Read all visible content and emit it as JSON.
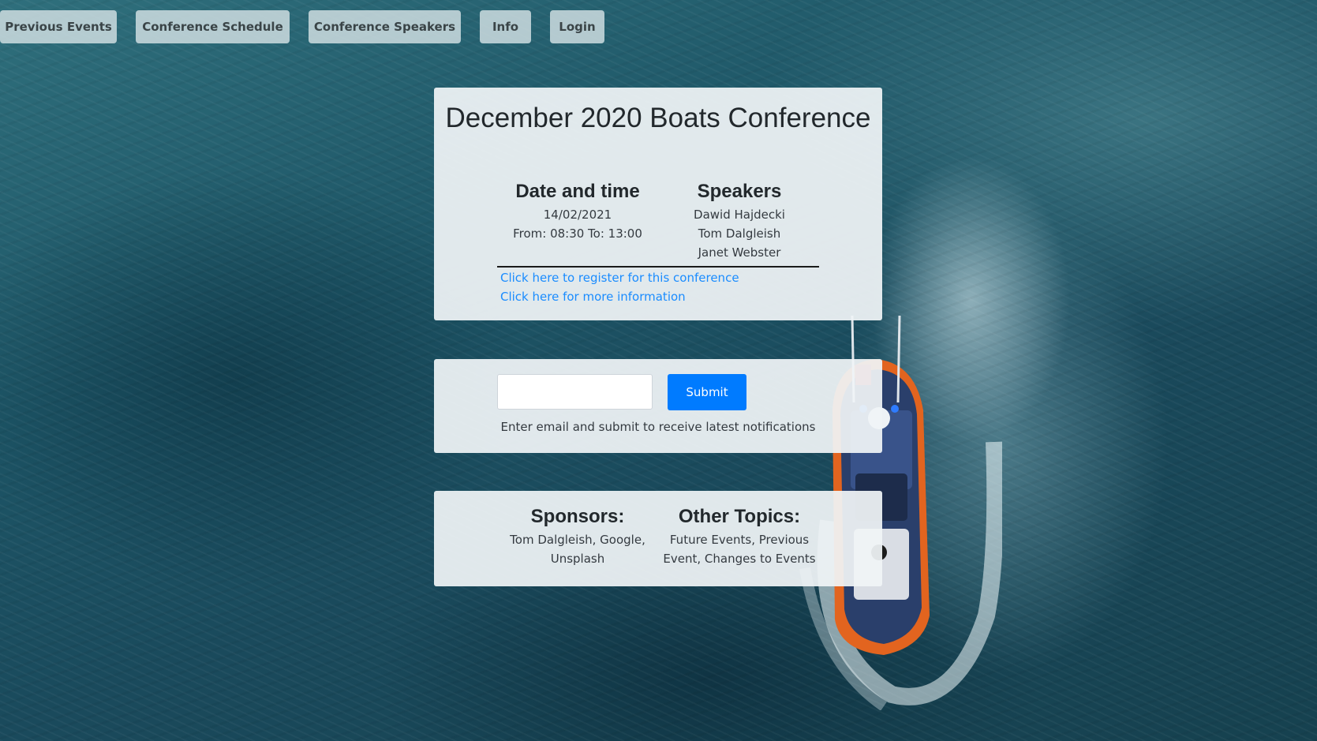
{
  "nav": {
    "items": [
      {
        "label": "Previous Events"
      },
      {
        "label": "Conference Schedule"
      },
      {
        "label": "Conference Speakers"
      },
      {
        "label": "Info"
      },
      {
        "label": "Login"
      }
    ]
  },
  "event": {
    "title": "December 2020 Boats Conference",
    "date_heading": "Date and time",
    "date": "14/02/2021",
    "time": "From: 08:30 To: 13:00",
    "speakers_heading": "Speakers",
    "speakers": [
      "Dawid Hajdecki",
      "Tom Dalgleish",
      "Janet Webster"
    ],
    "register_link": "Click here to register for this conference",
    "info_link": "Click here for more information"
  },
  "subscribe": {
    "email_value": "",
    "submit_label": "Submit",
    "helper_text": "Enter email and submit to receive latest notifications"
  },
  "footer": {
    "sponsors_heading": "Sponsors:",
    "sponsors_line1": "Tom Dalgleish, Google,",
    "sponsors_line2": "Unsplash",
    "topics_heading": "Other Topics:",
    "topics_line1": "Future Events, Previous",
    "topics_line2": "Event, Changes to Events"
  },
  "colors": {
    "accent": "#007bff",
    "link": "#1a8cff",
    "card_bg": "#f0f4f6",
    "nav_bg": "#cedde0"
  },
  "icons": [
    "boat-image"
  ]
}
